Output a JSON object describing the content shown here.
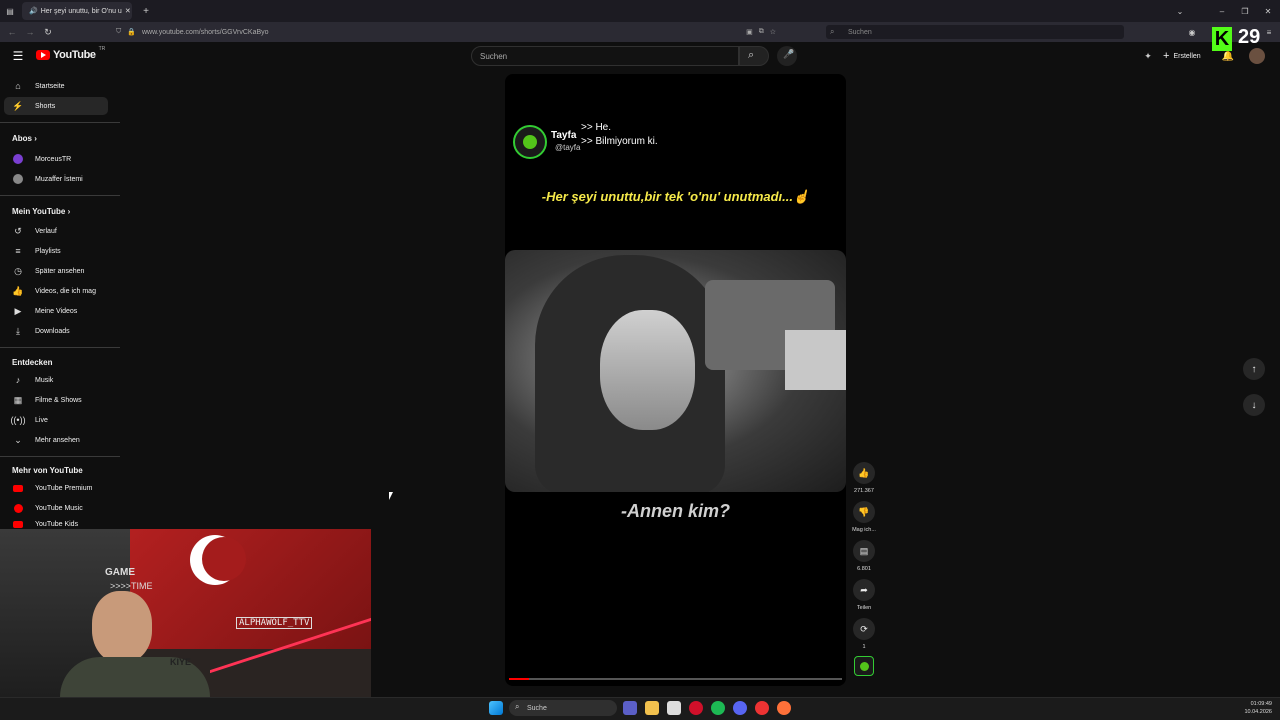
{
  "browser": {
    "tab_title": "Her şeyi unuttu, bir O'nu u",
    "url": "www.youtube.com/shorts/GGVrvCKaByo",
    "search_placeholder": "Suchen"
  },
  "header": {
    "logo": "YouTube",
    "logo_sup": "TR",
    "search_placeholder": "Suchen",
    "create_label": "Erstellen",
    "overlay_number": "29"
  },
  "sidebar": {
    "main": [
      {
        "label": "Startseite",
        "icon": "home-icon"
      },
      {
        "label": "Shorts",
        "icon": "shorts-icon"
      }
    ],
    "subs_head": "Abos",
    "subs": [
      {
        "label": "MorceusTR"
      },
      {
        "label": "Muzaffer İstemi"
      }
    ],
    "you_head": "Mein YouTube",
    "you": [
      {
        "label": "Verlauf",
        "icon": "history-icon"
      },
      {
        "label": "Playlists",
        "icon": "playlist-icon"
      },
      {
        "label": "Später ansehen",
        "icon": "clock-icon"
      },
      {
        "label": "Videos, die ich mag",
        "icon": "like-icon"
      },
      {
        "label": "Meine Videos",
        "icon": "video-icon"
      },
      {
        "label": "Downloads",
        "icon": "download-icon"
      }
    ],
    "explore_head": "Entdecken",
    "explore": [
      {
        "label": "Musik",
        "icon": "music-icon"
      },
      {
        "label": "Filme & Shows",
        "icon": "film-icon"
      },
      {
        "label": "Live",
        "icon": "live-icon"
      },
      {
        "label": "Mehr ansehen",
        "icon": "chevron-down-icon"
      }
    ],
    "more_head": "Mehr von YouTube",
    "more": [
      {
        "label": "YouTube Premium"
      },
      {
        "label": "YouTube Music"
      },
      {
        "label": "YouTube Kids"
      }
    ]
  },
  "video": {
    "channel": "Tayfa",
    "handle": "@tayfa",
    "subtitle_1": ">> He.",
    "subtitle_2": ">> Bilmiyorum ki.",
    "caption_top": "-Her şeyi unuttu,bir tek 'o'nu' unutmadı...☝",
    "caption_bottom": "-Annen kim?",
    "caption_color": "#f5e94a"
  },
  "actions": {
    "likes": "271.367",
    "dislike_label": "Mag ich...",
    "comments": "6.801",
    "share_label": "Teilen",
    "remix_count": "1"
  },
  "webcam": {
    "wall_text_1": "GAME",
    "wall_text_2": ">>>>TIME",
    "wall_text_3": "ALPHAWOLF_TTV",
    "shirt_text": "KIYE"
  },
  "taskbar": {
    "search_label": "Suche",
    "time": "01:09:49",
    "date": "10.04.2026"
  }
}
